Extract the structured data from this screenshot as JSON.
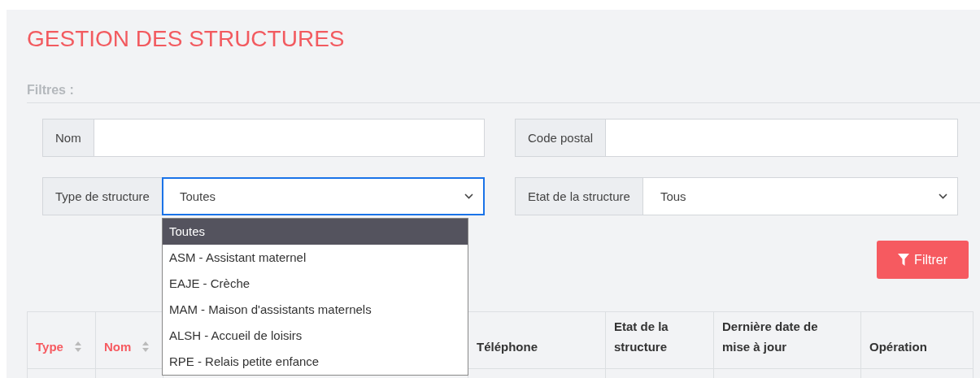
{
  "title": "GESTION DES STRUCTURES",
  "filters_heading": "Filtres :",
  "filters": [
    {
      "kind": "text",
      "label": "Nom"
    },
    {
      "kind": "text",
      "label": "Code postal"
    },
    {
      "kind": "select",
      "label": "Type de structure",
      "value": "Toutes",
      "open": true,
      "options": [
        {
          "label": "Toutes",
          "selected": true
        },
        {
          "label": "ASM - Assistant maternel",
          "selected": false
        },
        {
          "label": "EAJE - Crèche",
          "selected": false
        },
        {
          "label": "MAM - Maison d'assistants maternels",
          "selected": false
        },
        {
          "label": "ALSH - Accueil de loisirs",
          "selected": false
        },
        {
          "label": "RPE - Relais petite enfance",
          "selected": false
        }
      ]
    },
    {
      "kind": "select",
      "label": "Etat de la structure",
      "value": "Tous",
      "open": false
    }
  ],
  "filter_button": "Filtrer",
  "table": {
    "columns": [
      {
        "label": "Type",
        "sortable": true
      },
      {
        "label": "Nom",
        "sortable": true
      },
      {
        "label": "Téléphone",
        "sortable": false
      },
      {
        "label": "Etat de la structure",
        "sortable": false
      },
      {
        "label": "Dernière date de mise à jour",
        "sortable": false
      },
      {
        "label": "Opération",
        "sortable": false
      }
    ]
  }
}
